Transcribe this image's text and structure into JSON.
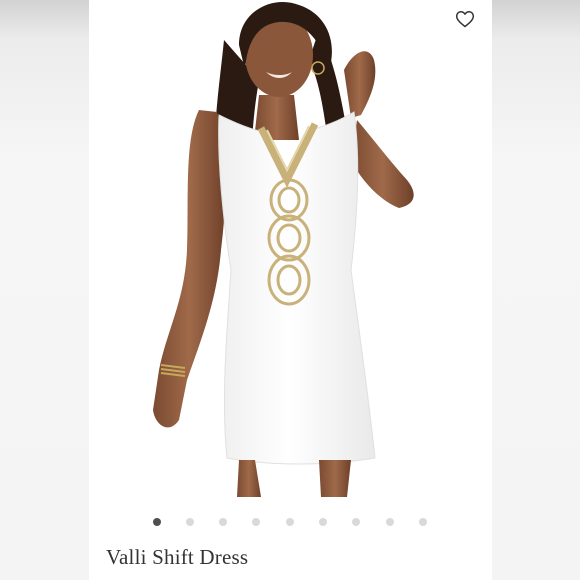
{
  "product": {
    "title": "Valli Shift Dress",
    "image_count": 9,
    "active_image_index": 0
  },
  "icons": {
    "favorite": "heart-outline-icon"
  },
  "colors": {
    "dress": "#ffffff",
    "trim_gold": "#c9b27a",
    "dot_active": "#4f4f4f",
    "dot_inactive": "#d9d9d9"
  }
}
